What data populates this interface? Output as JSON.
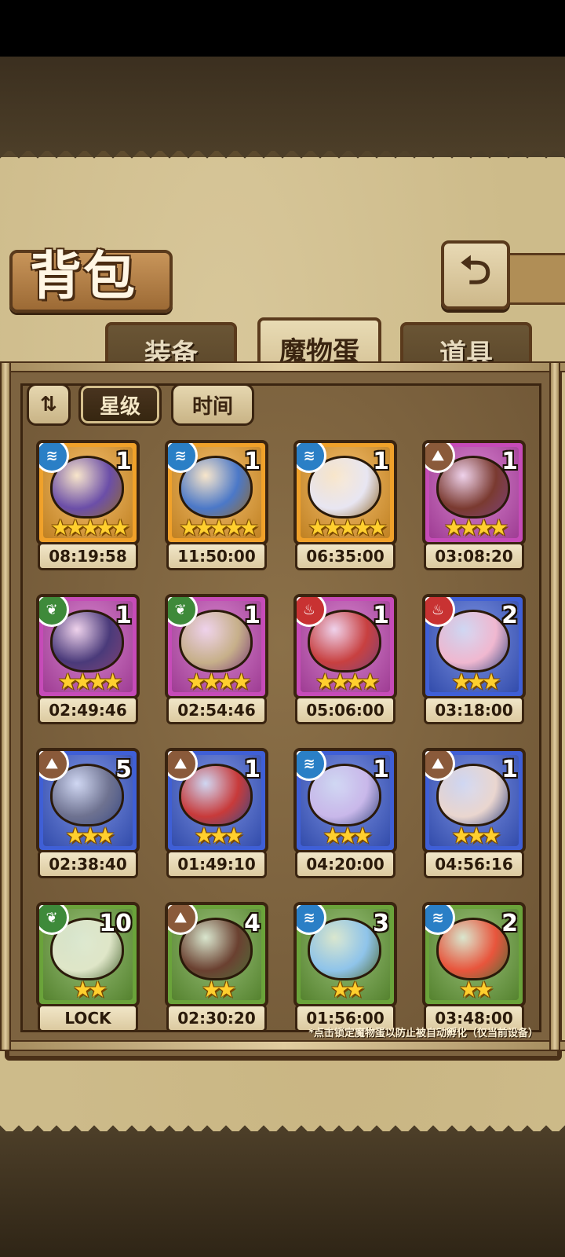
{
  "title": "背包",
  "back_glyph": "⮌",
  "tabs": [
    {
      "label": "装备",
      "active": false
    },
    {
      "label": "魔物蛋",
      "active": true
    },
    {
      "label": "道具",
      "active": false
    }
  ],
  "sort_toggle_glyph": "⇅",
  "filters": [
    {
      "label": "星级",
      "selected": true
    },
    {
      "label": "时间",
      "selected": false
    }
  ],
  "element_colors": {
    "water": "#2a7fc6",
    "earth": "#8a5a3a",
    "nature": "#3e8a3a",
    "fire": "#c83232"
  },
  "rarity_colors": {
    "gold": "#f0a12a",
    "purple": "#c64bb8",
    "blue": "#3f5fd6",
    "green": "#6aa33a"
  },
  "eggs": [
    {
      "element": "water",
      "element_icon": "water-icon",
      "count": "1",
      "stars": "★★★★★",
      "timer": "08:19:58",
      "rarity": "gold",
      "art": "#6b4ea8"
    },
    {
      "element": "water",
      "element_icon": "water-icon",
      "count": "1",
      "stars": "★★★★★",
      "timer": "11:50:00",
      "rarity": "gold",
      "art": "#4b78c8"
    },
    {
      "element": "water",
      "element_icon": "water-icon",
      "count": "1",
      "stars": "★★★★★",
      "timer": "06:35:00",
      "rarity": "gold",
      "art": "#e8e6f2"
    },
    {
      "element": "earth",
      "element_icon": "earth-icon",
      "count": "1",
      "stars": "★★★★",
      "timer": "03:08:20",
      "rarity": "purple",
      "art": "#7a3a30"
    },
    {
      "element": "nature",
      "element_icon": "leaf-icon",
      "count": "1",
      "stars": "★★★★",
      "timer": "02:49:46",
      "rarity": "purple",
      "art": "#4a3a7a"
    },
    {
      "element": "nature",
      "element_icon": "leaf-icon",
      "count": "1",
      "stars": "★★★★",
      "timer": "02:54:46",
      "rarity": "purple",
      "art": "#c7b08a"
    },
    {
      "element": "fire",
      "element_icon": "fire-icon",
      "count": "1",
      "stars": "★★★★",
      "timer": "05:06:00",
      "rarity": "purple",
      "art": "#c84040"
    },
    {
      "element": "fire",
      "element_icon": "fire-icon",
      "count": "2",
      "stars": "★★★",
      "timer": "03:18:00",
      "rarity": "blue",
      "art": "#f0b8d0"
    },
    {
      "element": "earth",
      "element_icon": "earth-icon",
      "count": "5",
      "stars": "★★★",
      "timer": "02:38:40",
      "rarity": "blue",
      "art": "#6e7290"
    },
    {
      "element": "earth",
      "element_icon": "earth-icon",
      "count": "1",
      "stars": "★★★",
      "timer": "01:49:10",
      "rarity": "blue",
      "art": "#c83a3a"
    },
    {
      "element": "water",
      "element_icon": "water-icon",
      "count": "1",
      "stars": "★★★",
      "timer": "04:20:00",
      "rarity": "blue",
      "art": "#c9b8ea"
    },
    {
      "element": "earth",
      "element_icon": "earth-icon",
      "count": "1",
      "stars": "★★★",
      "timer": "04:56:16",
      "rarity": "blue",
      "art": "#ead6cf"
    },
    {
      "element": "nature",
      "element_icon": "leaf-icon",
      "count": "10",
      "stars": "★★",
      "timer": "LOCK",
      "rarity": "green",
      "art": "#dfe6c8"
    },
    {
      "element": "earth",
      "element_icon": "earth-icon",
      "count": "4",
      "stars": "★★",
      "timer": "02:30:20",
      "rarity": "green",
      "art": "#6a4030"
    },
    {
      "element": "water",
      "element_icon": "water-icon",
      "count": "3",
      "stars": "★★",
      "timer": "01:56:00",
      "rarity": "green",
      "art": "#8fc4ea"
    },
    {
      "element": "water",
      "element_icon": "water-icon",
      "count": "2",
      "stars": "★★",
      "timer": "03:48:00",
      "rarity": "green",
      "art": "#e8553c"
    }
  ],
  "footer_note": "*点击锁定魔物蛋以防止被自动孵化（仅当前设备）"
}
